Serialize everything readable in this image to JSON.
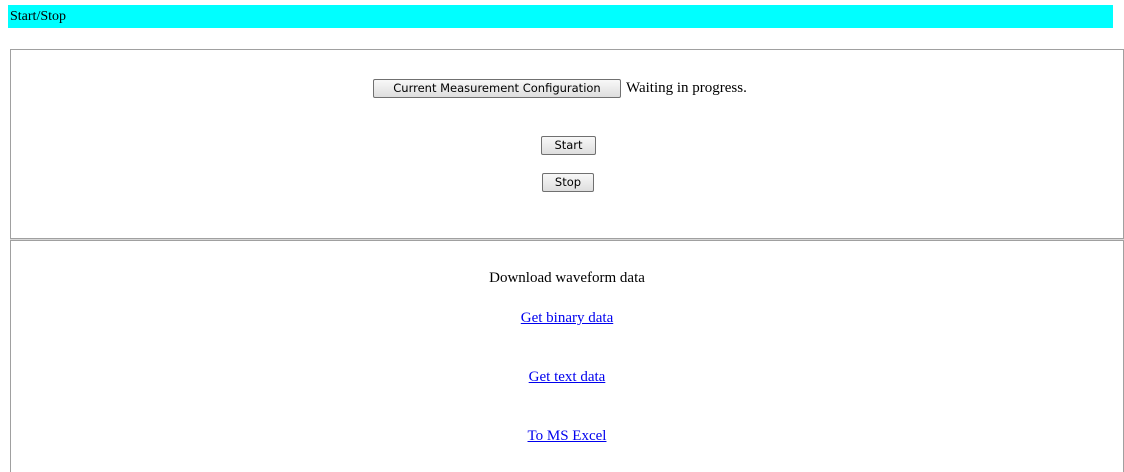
{
  "header": {
    "title": "Start/Stop"
  },
  "control": {
    "config_button_label": "Current Measurement Configuration",
    "status_text": "Waiting in progress.",
    "start_label": "Start",
    "stop_label": "Stop"
  },
  "download": {
    "heading": "Download waveform data",
    "links": [
      {
        "label": "Get binary data"
      },
      {
        "label": "Get text data"
      },
      {
        "label": "To MS Excel"
      }
    ]
  },
  "colors": {
    "title_bar": "#00ffff",
    "link": "#0000ee"
  }
}
